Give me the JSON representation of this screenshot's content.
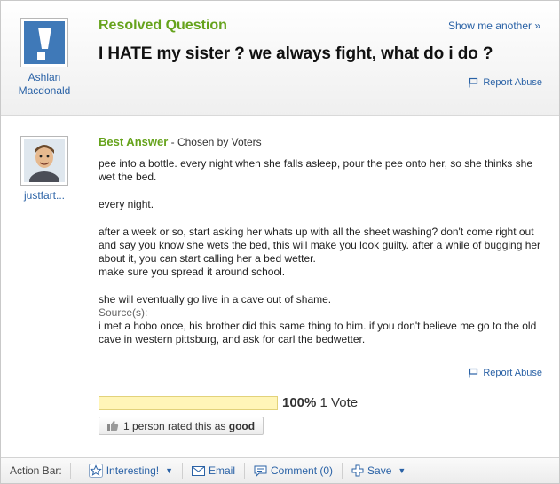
{
  "question": {
    "status_label": "Resolved Question",
    "show_another": "Show me another »",
    "title": "I HATE my sister ? we always fight, what do i do ?",
    "report_abuse": "Report Abuse",
    "asker": {
      "name_line1": "Ashlan",
      "name_line2": "Macdonald"
    }
  },
  "answer": {
    "heading": "Best Answer",
    "chosen_by": " - Chosen by Voters",
    "answerer": "justfart...",
    "paragraphs": [
      "pee into a bottle. every night when she falls asleep, pour the pee onto her, so she thinks she wet the bed.",
      "every night.",
      "after a week or so, start asking her whats up with all the sheet washing? don't come right out and say you know she wets the bed, this will make you look guilty. after a while of bugging her about it, you can start calling her a bed wetter.",
      "make sure you spread it around school.",
      "she will eventually go live in a cave out of shame."
    ],
    "sources_label": "Source(s):",
    "sources_text": "i met a hobo once, his brother did this same thing to him. if you don't believe me go to the old cave in western pittsburg, and ask for carl the bedwetter.",
    "report_abuse": "Report Abuse",
    "rating": {
      "percent": "100%",
      "votes": "1 Vote",
      "fill_fraction": 1.0,
      "rated_prefix": "1 person rated this as ",
      "rated_value": "good"
    }
  },
  "action_bar": {
    "label": "Action Bar:",
    "interesting": "Interesting!",
    "email": "Email",
    "comment": "Comment (0)",
    "save": "Save"
  },
  "colors": {
    "brand_green": "#66a31c",
    "link_blue": "#2a62a6",
    "rating_fill": "#fff5b8"
  }
}
